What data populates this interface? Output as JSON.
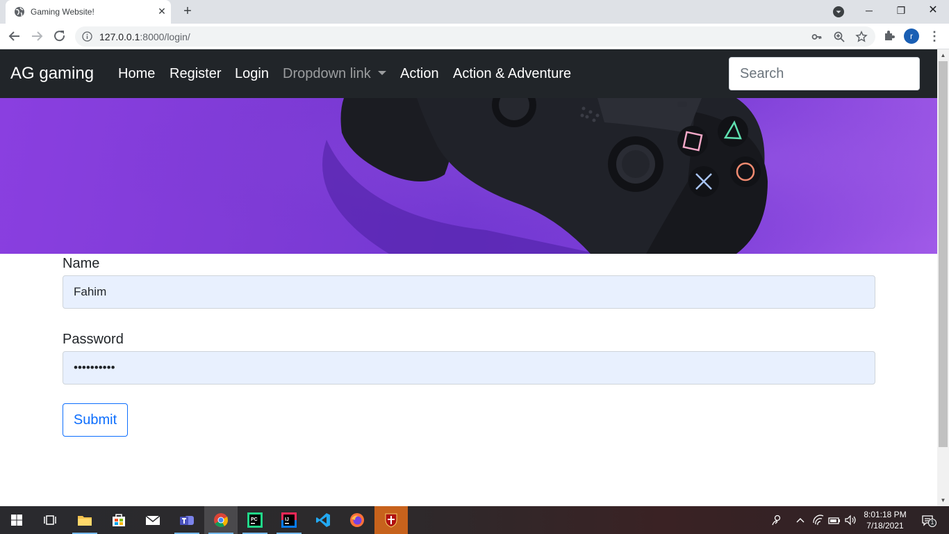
{
  "browser": {
    "tab_title": "Gaming Website!",
    "tab_close": "✕",
    "new_tab": "+",
    "url_host": "127.0.0.1",
    "url_path": ":8000/login/",
    "window_controls": {
      "minimize": "─",
      "restore": "❐",
      "close": "✕"
    },
    "profile_initial": "r",
    "menu": "⋮"
  },
  "site": {
    "brand": "AG gaming",
    "nav": {
      "home": "Home",
      "register": "Register",
      "login": "Login",
      "dropdown": "Dropdown link",
      "action": "Action",
      "action_adventure": "Action & Adventure"
    },
    "search_placeholder": "Search"
  },
  "form": {
    "name_label": "Name",
    "name_value": "Fahim",
    "password_label": "Password",
    "password_value": "••••••••••",
    "submit_label": "Submit"
  },
  "taskbar": {
    "time": "8:01:18 PM",
    "date": "7/18/2021",
    "notification_count": "1"
  },
  "colors": {
    "navbar": "#212529",
    "hero_purple": "#7e3bd6",
    "autofill_bg": "#e8f0fe",
    "primary": "#0d6efd"
  }
}
